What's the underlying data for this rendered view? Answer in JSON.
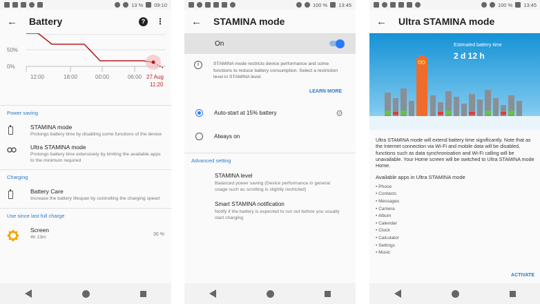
{
  "screen1": {
    "status": {
      "battery": "13 %",
      "time": "09:10"
    },
    "title": "Battery",
    "help_icon": "?",
    "chart": {
      "y_ticks": [
        "50%",
        "0%"
      ],
      "x_ticks": [
        "12:00",
        "18:00",
        "00:00",
        "06:00"
      ],
      "date_label": "27 Aug",
      "time_label": "11:20",
      "line_color": "#b71c1c"
    },
    "sections": {
      "power_saving": "Power saving",
      "charging": "Charging",
      "usage": "Use since last full charge"
    },
    "items": [
      {
        "title": "STAMINA mode",
        "desc": "Prolongs battery time by disabling some functions of the device"
      },
      {
        "title": "Ultra STAMINA mode",
        "desc": "Prolongs battery time extensively by limiting the available apps to the minimum required"
      },
      {
        "title": "Battery Care",
        "desc": "Increase the battery lifespan by controlling the charging speed"
      }
    ],
    "usage_item": {
      "title": "Screen",
      "duration": "4h 13m",
      "percent": "30 %"
    }
  },
  "screen2": {
    "status": {
      "battery": "100 %",
      "time": "13:45"
    },
    "title": "STAMINA mode",
    "toggle_label": "On",
    "info_text": "STAMINA mode restricts device performance and some functions to reduce battery consumption. Select a restriction level in STAMINA level.",
    "learn_more": "LEARN MORE",
    "options": [
      {
        "label": "Auto-start at 15% battery",
        "selected": true
      },
      {
        "label": "Always on",
        "selected": false
      }
    ],
    "advanced_header": "Advanced setting",
    "advanced_items": [
      {
        "title": "STAMINA level",
        "desc": "Balanced power saving (Device performance in general usage such as scrolling is slightly restricted)"
      },
      {
        "title": "Smart STAMINA notification",
        "desc": "Notify if the battery is expected to run out before you usually start charging"
      }
    ]
  },
  "screen3": {
    "status": {
      "battery": "100 %",
      "time": "13:45"
    },
    "title": "Ultra STAMINA mode",
    "estimated_label": "Estimated battery time",
    "estimated_value": "2 d 12 h",
    "description": "Ultra STAMINA mode will extend battery time significantly. Note that as the Internet connection via Wi-Fi and mobile data will be disabled, functions such as data synchronisation and Wi-Fi calling will be unavailable. Your Home screen will be switched to Ultra STAMINA mode Home.",
    "apps_header": "Available apps in Ultra STAMINA mode",
    "apps": [
      "• Phone",
      "• Contacts",
      "• Messages",
      "• Camera",
      "• Album",
      "• Calendar",
      "• Clock",
      "• Calculator",
      "• Settings",
      "• Music"
    ],
    "activate": "ACTIVATE",
    "colors": {
      "accent_bar": "#ef6c2b",
      "bars": "#8a8f96"
    }
  }
}
